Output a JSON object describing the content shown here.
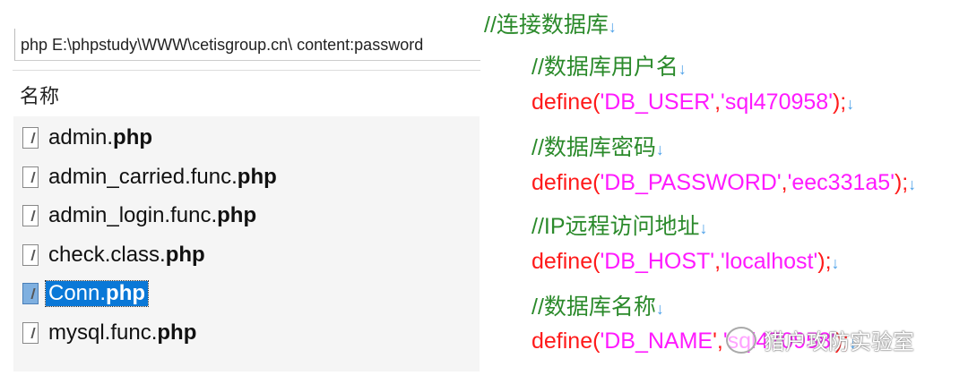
{
  "search": {
    "value": "php E:\\phpstudy\\WWW\\cetisgroup.cn\\ content:password"
  },
  "list": {
    "column_header": "名称",
    "files": [
      {
        "base": "admin.",
        "ext": "php"
      },
      {
        "base": "admin_carried.func.",
        "ext": "php"
      },
      {
        "base": "admin_login.func.",
        "ext": "php"
      },
      {
        "base": "check.class.",
        "ext": "php"
      },
      {
        "base": "Conn.",
        "ext": "php",
        "selected": true
      },
      {
        "base": "mysql.func.",
        "ext": "php"
      }
    ]
  },
  "code": {
    "arrow": "↓",
    "l0": "//连接数据库",
    "l1": "//数据库用户名",
    "l2": {
      "fn": "define(",
      "a": "'DB_USER'",
      "c": ",",
      "b": "'sql470958'",
      "end": ");"
    },
    "l3": "//数据库密码",
    "l4": {
      "fn": "define(",
      "a": "'DB_PASSWORD'",
      "c": ",",
      "b": "'eec331a5'",
      "end": ");"
    },
    "l5": "//IP远程访问地址",
    "l6": {
      "fn": "define(",
      "a": "'DB_HOST'",
      "c": ",",
      "b": "'localhost'",
      "end": ");"
    },
    "l7": "//数据库名称",
    "l8": {
      "fn": "define(",
      "a": "'DB_NAME",
      "c": "',",
      "b": "'sql470958'",
      "end": ");"
    }
  },
  "watermark": "猎户攻防实验室"
}
